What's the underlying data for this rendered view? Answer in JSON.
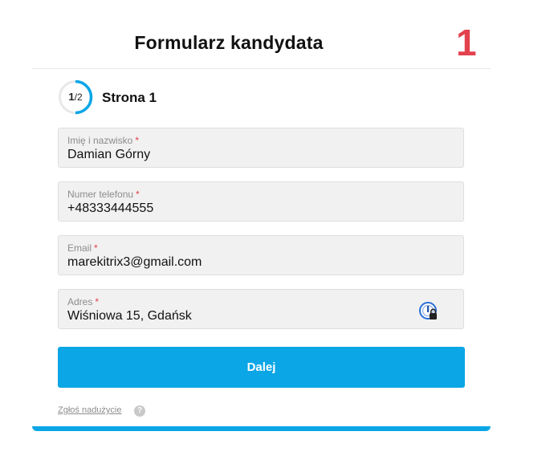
{
  "header": {
    "title": "Formularz kandydata",
    "counter": "1"
  },
  "progress": {
    "current": "1",
    "separator": "/",
    "total": "2",
    "fraction": 0.5,
    "page_label": "Strona 1",
    "accent_color": "#0ba6e6"
  },
  "fields": [
    {
      "label": "Imię i nazwisko",
      "required_mark": "*",
      "value": "Damian Górny"
    },
    {
      "label": "Numer telefonu",
      "required_mark": "*",
      "value": "+48333444555"
    },
    {
      "label": "Email",
      "required_mark": "*",
      "value": "marekitrix3@gmail.com"
    },
    {
      "label": "Adres",
      "required_mark": "*",
      "value": "Wiśniowa 15, Gdańsk",
      "icon": "password-manager-lock-icon"
    }
  ],
  "actions": {
    "next_label": "Dalej"
  },
  "footer": {
    "report_label": "Zgłoś nadużycie",
    "help_glyph": "?"
  },
  "colors": {
    "accent": "#0ba6e6",
    "badge": "#e2424d"
  }
}
